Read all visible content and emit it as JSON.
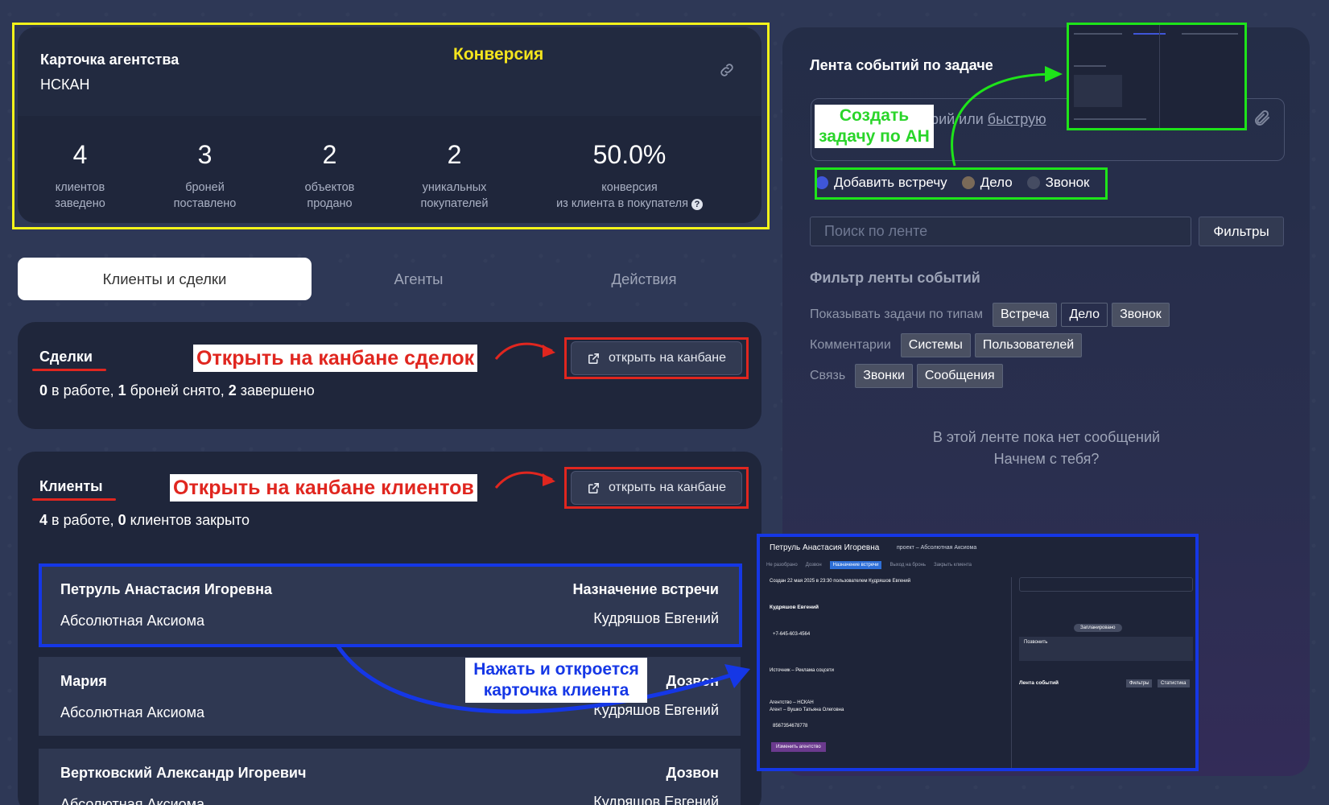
{
  "agency": {
    "title": "Карточка агентства",
    "name": "НСКАН",
    "stats": [
      {
        "value": "4",
        "label1": "клиентов",
        "label2": "заведено"
      },
      {
        "value": "3",
        "label1": "броней",
        "label2": "поставлено"
      },
      {
        "value": "2",
        "label1": "объектов",
        "label2": "продано"
      },
      {
        "value": "2",
        "label1": "уникальных",
        "label2": "покупателей"
      },
      {
        "value": "50.0%",
        "label1": "конверсия",
        "label2": "из клиента в покупателя"
      }
    ]
  },
  "annotations": {
    "conversion": "Конверсия",
    "open_deals": "Открыть на канбане сделок",
    "open_clients": "Открыть на канбане клиентов",
    "create_task_line1": "Создать",
    "create_task_line2": "задачу по АН",
    "click_opens_line1": "Нажать и откроется",
    "click_opens_line2": "карточка клиента"
  },
  "tabs": [
    "Клиенты и сделки",
    "Агенты",
    "Действия"
  ],
  "deals": {
    "title": "Сделки",
    "n1": "0",
    "t1": " в работе, ",
    "n2": "1",
    "t2": " броней снято, ",
    "n3": "2",
    "t3": " завершено",
    "button": "открыть на канбане"
  },
  "clients": {
    "title": "Клиенты",
    "n1": "4",
    "t1": " в работе, ",
    "n2": "0",
    "t2": " клиентов закрыто",
    "button": "открыть на канбане",
    "rows": [
      {
        "name": "Петруль Анастасия Игоревна",
        "company": "Абсолютная Аксиома",
        "stage": "Назначение встречи",
        "agent": "Кудряшов Евгений"
      },
      {
        "name": "Мария",
        "company": "Абсолютная Аксиома",
        "stage": "Дозвон",
        "agent": "Кудряшов Евгений"
      },
      {
        "name": "Вертковский Александр Игоревич",
        "company": "Абсолютная Аксиома",
        "stage": "Дозвон",
        "agent": "Кудряшов Евгений"
      }
    ]
  },
  "feed": {
    "title": "Лента событий по задаче",
    "comment_prefix": "тарий или ",
    "comment_link": "быструю",
    "radios": [
      {
        "label": "Добавить встречу",
        "color": "#3f56d8"
      },
      {
        "label": "Дело",
        "color": "#7a6a58"
      },
      {
        "label": "Звонок",
        "color": "#454c62"
      }
    ],
    "search_placeholder": "Поиск по ленте",
    "filters_button": "Фильтры",
    "filter_title": "Фильтр ленты событий",
    "types_label": "Показывать задачи по типам",
    "types": [
      "Встреча",
      "Дело",
      "Звонок"
    ],
    "comments_label": "Комментарии",
    "comments": [
      "Системы",
      "Пользователей"
    ],
    "link_label": "Связь",
    "link": [
      "Звонки",
      "Сообщения"
    ],
    "empty_line1": "В этой ленте пока нет сообщений",
    "empty_line2": "Начнем с тебя?"
  },
  "preview": {
    "name": "Петруль Анастасия Игоревна",
    "project": "проект – Абсолютная Аксиома",
    "steps": [
      "Не разобрано",
      "Дозвон",
      "Назначение встречи",
      "Выход на бронь",
      "Закрыть клиента"
    ],
    "created": "Создан 22 мая 2025 в 23:30 пользователем Кудряшов Евгений",
    "responsible": "Кудряшов Евгений",
    "phone": "+7-645-603-4564",
    "source": "Источник – Реклама соцсети",
    "agency": "Агентство – НСКАН",
    "agent": "Агент – Вушко Татьяна Олеговна",
    "phone2": "8567354678778",
    "change_agency": "Изменить агентство",
    "planned": "Запланировано",
    "call": "Позвонить",
    "feed_events": "Лента событий",
    "filters": "Фильтры",
    "stats": "Статистика"
  },
  "colors": {
    "yellow": "#f3f31a",
    "red": "#e0261f",
    "green": "#1ee41a",
    "blue": "#1537e6"
  }
}
